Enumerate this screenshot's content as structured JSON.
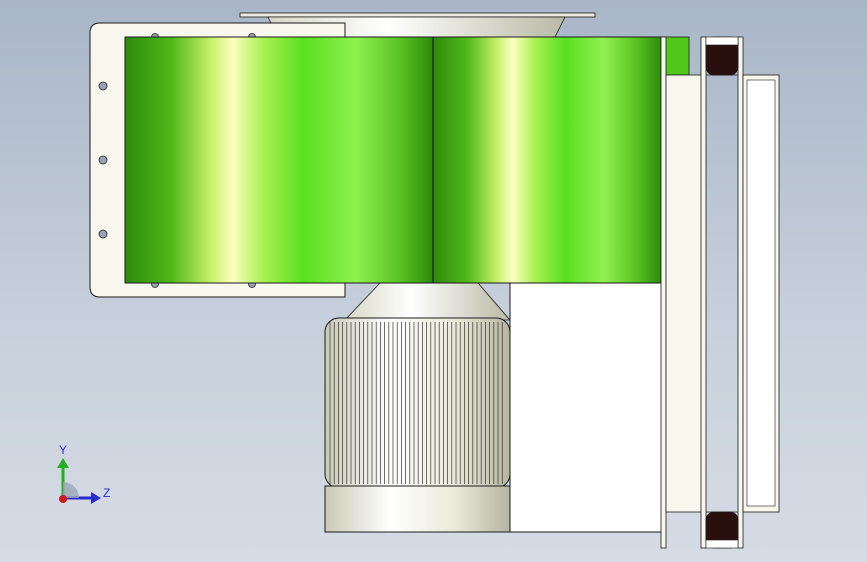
{
  "viewport": {
    "background_top": "#a9b6c8",
    "background_bottom": "#d6dce5"
  },
  "model": {
    "housing_color": "#4fc81a",
    "housing_highlight": "#fbffc0",
    "flange_color": "#f7f7ee",
    "motor_color": "#f2f2e6",
    "outline_color": "#1a1a1a",
    "belt_color": "#2a0f0f"
  },
  "triad": {
    "y_label": "Y",
    "z_label": "Z",
    "y_color": "#22b022",
    "z_color": "#2a2ad0",
    "x_color": "#d01818",
    "icon": "coordinate-triad-icon"
  }
}
